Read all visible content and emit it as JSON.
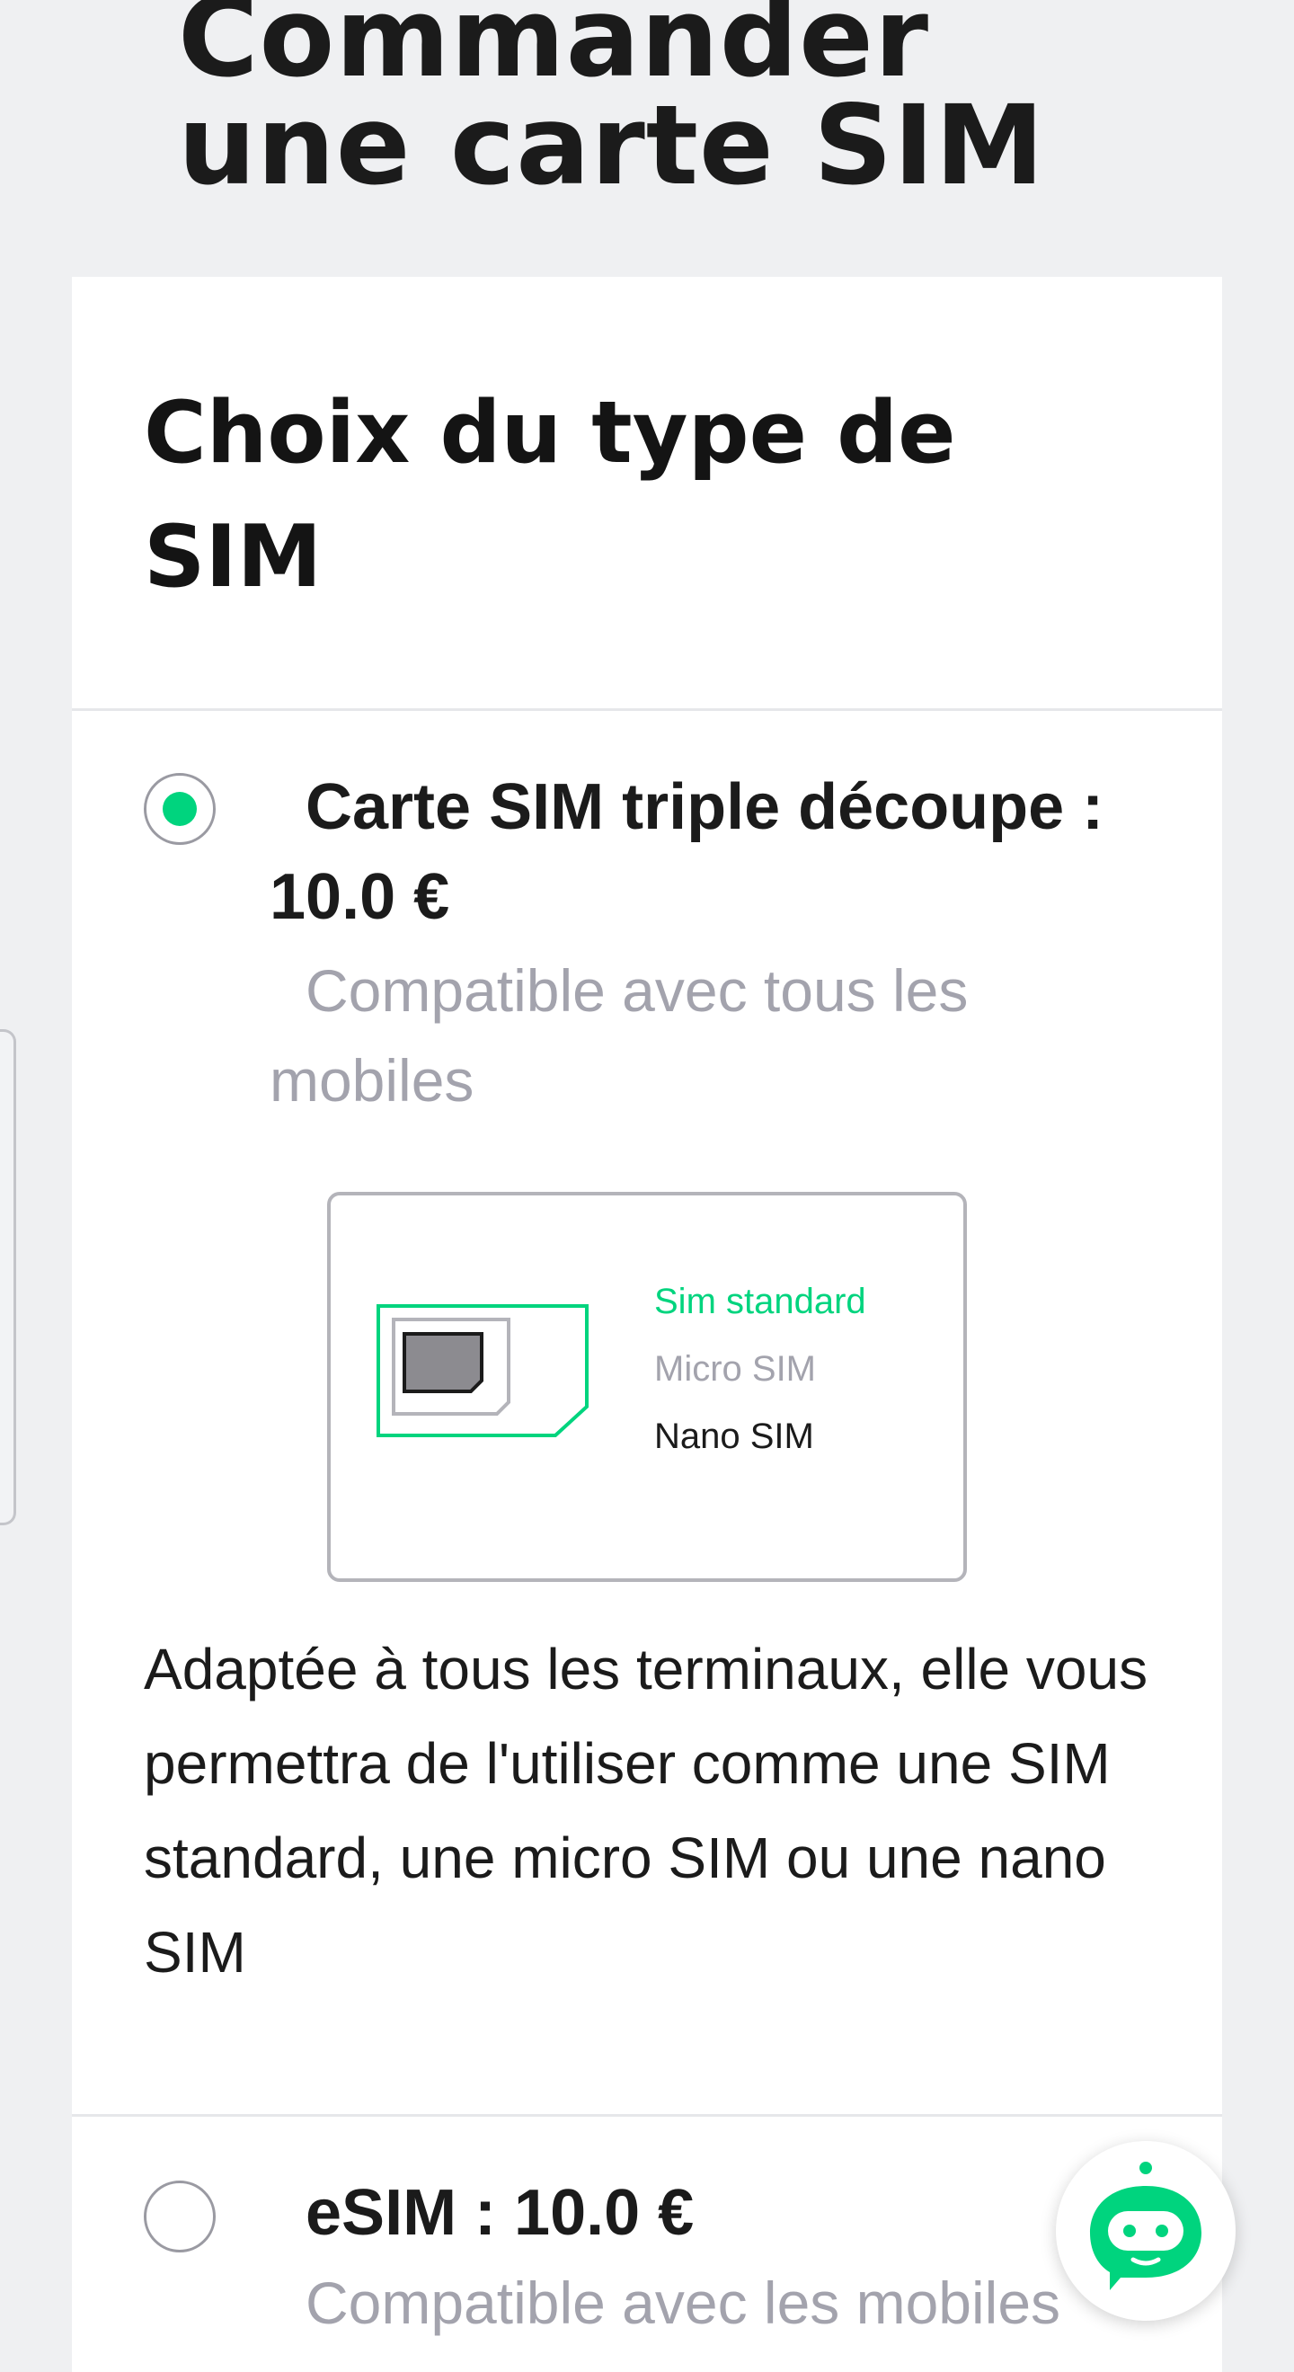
{
  "page": {
    "title_line1": "Commander",
    "title_line2": "une carte SIM"
  },
  "card": {
    "heading": "Choix du type de SIM"
  },
  "options": [
    {
      "title": "Carte SIM triple découpe : 10.0 €",
      "subtitle": "Compatible avec tous les mobiles",
      "selected": true
    },
    {
      "title": "eSIM : 10.0 €",
      "subtitle": "Compatible avec les mobiles",
      "selected": false
    }
  ],
  "sim_illustration": {
    "standard": "Sim standard",
    "micro": "Micro SIM",
    "nano": "Nano SIM"
  },
  "description": "Adaptée à tous les terminaux, elle vous permettra de l'utiliser comme une SIM standard, une micro SIM ou une nano SIM",
  "colors": {
    "accent": "#00d47e",
    "muted": "#a3a3ad",
    "background": "#eff0f2"
  },
  "icons": {
    "chat": "chatbot-icon",
    "sim": "sim-card-icon"
  }
}
